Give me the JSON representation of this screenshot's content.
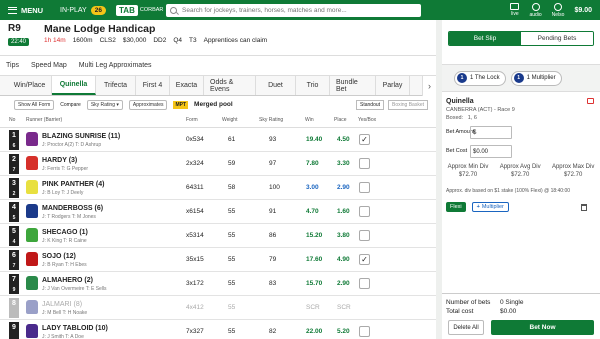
{
  "topbar": {
    "menu_label": "MENU",
    "inplay_label": "IN-PLAY",
    "inplay_count": "26",
    "logo_text": "TAB",
    "logo_sub": "CORBAR",
    "search_placeholder": "Search for jockeys, trainers, horses, matches and more...",
    "icons": [
      {
        "name": "live-vision-icon",
        "label": "live"
      },
      {
        "name": "audio-icon",
        "label": "audio"
      },
      {
        "name": "my-account-icon",
        "label": "Nelso"
      }
    ],
    "balance": "$9.00"
  },
  "race": {
    "number": "R9",
    "time": "22:40",
    "name": "Mane Lodge Handicap",
    "countdown": "1h 14m",
    "distance": "1600m",
    "class": "CLS2",
    "prize": "$30,000",
    "track": "DD2",
    "rating": "Q4",
    "weather": "T3",
    "claim": "Apprentices can claim"
  },
  "subnav": [
    "Tips",
    "Speed Map",
    "Multi Leg Approximates"
  ],
  "bet_tabs": [
    "Win/Place",
    "Quinella",
    "Trifecta",
    "First 4",
    "Exacta",
    "Odds & Evens",
    "Duet",
    "Trio",
    "Bundle Bet",
    "Parlay"
  ],
  "active_tab": "Quinella",
  "filters": {
    "show_all_form": "Show All Form",
    "compare_label": "Compare",
    "compare_value": "Sky Rating",
    "approximates": "Approximates",
    "mpt": "MPT",
    "merged_pool": "Merged pool",
    "standout": "Standout",
    "boxing": "Boxing Basket"
  },
  "table": {
    "headers": {
      "no": "No",
      "runner": "Runner (Barrier)",
      "form": "Form",
      "weight": "Weight",
      "sky": "Sky Rating",
      "win": "Win",
      "place": "Place",
      "yesno": "Yes/Box"
    },
    "rows": [
      {
        "no": "1",
        "exp": "6",
        "name": "BLAZING SUNRISE (11)",
        "jockey": "J: Proctor A(2)  T: D Ashrup",
        "form": "0x534",
        "weight": "61",
        "sky": "93",
        "win": "19.40",
        "place": "4.50",
        "checked": "✓",
        "win_color": "green",
        "silk": "#7a2a8c",
        "scratched": false
      },
      {
        "no": "2",
        "exp": "7",
        "name": "HARDY (3)",
        "jockey": "J: Ferris  T: G Pepper",
        "form": "2x324",
        "weight": "59",
        "sky": "97",
        "win": "7.80",
        "place": "3.30",
        "checked": "",
        "win_color": "green",
        "silk": "#d6302a",
        "scratched": false
      },
      {
        "no": "3",
        "exp": "2",
        "name": "PINK PANTHER (4)",
        "jockey": "J: B Loy  T: J Deely",
        "form": "64311",
        "weight": "58",
        "sky": "100",
        "win": "3.00",
        "place": "2.90",
        "checked": "",
        "win_color": "blue",
        "silk": "#e8e040",
        "scratched": false
      },
      {
        "no": "4",
        "exp": "5",
        "name": "MANDERBOSS (6)",
        "jockey": "J: T Rodgers  T: M Jones",
        "form": "x6154",
        "weight": "55",
        "sky": "91",
        "win": "4.70",
        "place": "1.60",
        "checked": "",
        "win_color": "green",
        "silk": "#1b3a8a",
        "scratched": false
      },
      {
        "no": "5",
        "exp": "4",
        "name": "SHECAGO (1)",
        "jockey": "J: K King  T: R Caine",
        "form": "x5314",
        "weight": "55",
        "sky": "86",
        "win": "15.20",
        "place": "3.80",
        "checked": "",
        "win_color": "green",
        "silk": "#3ea63c",
        "scratched": false
      },
      {
        "no": "6",
        "exp": "7",
        "name": "SOJO (12)",
        "jockey": "J: B Ryan  T: H Ebes",
        "form": "35x15",
        "weight": "55",
        "sky": "79",
        "win": "17.60",
        "place": "4.90",
        "checked": "✓",
        "win_color": "green",
        "silk": "#c01818",
        "scratched": false
      },
      {
        "no": "7",
        "exp": "9",
        "name": "ALMAHERO (2)",
        "jockey": "J: J Van Overmeire  T: E Sells",
        "form": "3x172",
        "weight": "55",
        "sky": "83",
        "win": "15.70",
        "place": "2.90",
        "checked": "",
        "win_color": "green",
        "silk": "#2a8a4a",
        "scratched": false
      },
      {
        "no": "8",
        "exp": "",
        "name": "JALMARI (8)",
        "jockey": "J: M Bell  T: H Noake",
        "form": "4x412",
        "weight": "55",
        "sky": "",
        "win": "SCR",
        "place": "SCR",
        "checked": "",
        "win_color": "grey",
        "silk": "#9aa0c8",
        "scratched": true
      },
      {
        "no": "9",
        "exp": "",
        "name": "LADY TABLOID (10)",
        "jockey": "J: J Smith  T: A Doe",
        "form": "7x327",
        "weight": "55",
        "sky": "82",
        "win": "22.00",
        "place": "5.20",
        "checked": "",
        "win_color": "green",
        "silk": "#4a2a8c",
        "scratched": false
      }
    ]
  },
  "betslip": {
    "tab_betslip": "Bet Slip",
    "tab_pending": "Pending Bets",
    "promo1": "1 The Lock",
    "promo2": "1 Multiplier",
    "promo1_icon": "1",
    "promo2_icon": "1",
    "bet_type": "Quinella",
    "race_info": "CANBERRA (ACT) - Race 9",
    "boxed_label": "Boxed:",
    "boxed_value": "1, 6",
    "amount_label": "Bet Amount",
    "amount_value": "$",
    "cost_label": "Bet Cost",
    "cost_value": "$0.00",
    "div_min_label": "Approx Min Div",
    "div_avg_label": "Approx Avg Div",
    "div_max_label": "Approx Max Div",
    "div_min": "$72.70",
    "div_avg": "$72.70",
    "div_max": "$72.70",
    "approx_note": "Approx. div based on $1 stake (100% Flexi) @ 18:40:00",
    "flexi_label": "Flexi",
    "multiplier_label": "Multiplier",
    "bets_label": "Number of bets",
    "bets_value": "0 Single",
    "total_label": "Total cost",
    "total_value": "$0.00",
    "delete_all": "Delete All",
    "bet_now": "Bet Now"
  }
}
